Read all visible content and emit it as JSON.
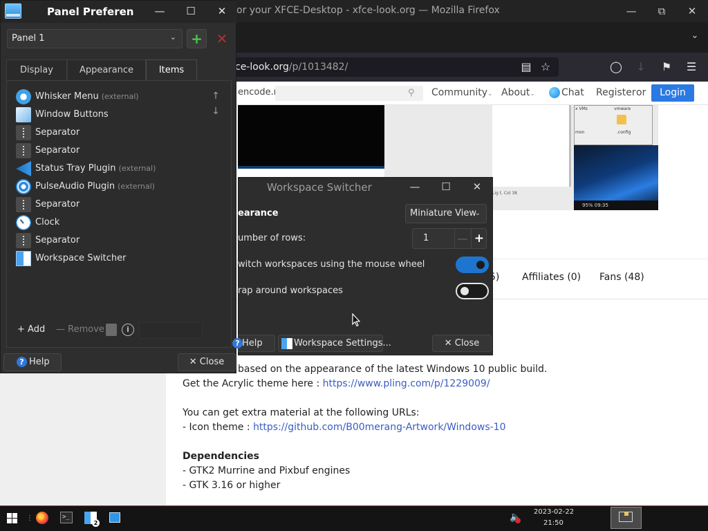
{
  "firefox": {
    "window_title": "or your XFCE-Desktop - xfce-look.org — Mozilla Firefox",
    "url_host": "ce-look.org",
    "url_path": "/p/1013482/"
  },
  "site": {
    "logo_fragment": "encode.n",
    "nav": {
      "community": "Community",
      "about": "About",
      "chat": "Chat",
      "register": "Register",
      "or": "or",
      "login": "Login"
    },
    "screenshot": {
      "label1": "x VMs",
      "label2": "vmware",
      "label3": "mon",
      "label4": ".config",
      "statusline": "Lig t, Col 38",
      "taskbar_text": "95%  09:35"
    },
    "tabs": {
      "partial": "5)",
      "affiliates": "Affiliates (0)",
      "fans": "Fans (48)"
    },
    "description": {
      "line1": "based on the appearance of the latest Windows 10 public build.",
      "line2_prefix": "Get the Acrylic theme here : ",
      "line2_link": "https://www.pling.com/p/1229009/",
      "line3": "You can get extra material at the following URLs:",
      "line4_prefix": "- Icon theme : ",
      "line4_link": "https://github.com/B00merang-Artwork/Windows-10",
      "deps_heading": "Dependencies",
      "dep1": "- GTK2 Murrine and Pixbuf engines",
      "dep2": "- GTK 3.16 or higher"
    }
  },
  "panel_prefs": {
    "title": "Panel Preferen",
    "selected_panel": "Panel 1",
    "tabs": [
      "Display",
      "Appearance",
      "Items"
    ],
    "active_tab": "Items",
    "items": [
      {
        "label": "Whisker Menu",
        "external": "(external)",
        "icon": "whisker-menu-icon"
      },
      {
        "label": "Window Buttons",
        "external": "",
        "icon": "window-buttons-icon"
      },
      {
        "label": "Separator",
        "external": "",
        "icon": "separator-icon"
      },
      {
        "label": "Separator",
        "external": "",
        "icon": "separator-icon"
      },
      {
        "label": "Status Tray Plugin",
        "external": "(external)",
        "icon": "status-tray-icon"
      },
      {
        "label": "PulseAudio Plugin",
        "external": "(external)",
        "icon": "pulseaudio-icon"
      },
      {
        "label": "Separator",
        "external": "",
        "icon": "separator-icon"
      },
      {
        "label": "Clock",
        "external": "",
        "icon": "clock-icon"
      },
      {
        "label": "Separator",
        "external": "",
        "icon": "separator-icon"
      },
      {
        "label": "Workspace Switcher",
        "external": "",
        "icon": "workspace-switcher-icon"
      }
    ],
    "add_label": "Add",
    "remove_label": "Remove",
    "help_label": "Help",
    "close_label": "Close"
  },
  "workspace_switcher": {
    "title": "Workspace Switcher",
    "appearance_label": "earance",
    "appearance_value": "Miniature View",
    "rows_label": "umber of rows:",
    "rows_value": "1",
    "mouse_wheel_label": "witch workspaces using the mouse wheel",
    "mouse_wheel_on": true,
    "wrap_label": "rap around workspaces",
    "wrap_on": false,
    "help_label": "Help",
    "settings_label": "Workspace Settings...",
    "close_label": "Close"
  },
  "taskbar": {
    "date": "2023-02-22",
    "time": "21:50",
    "workspace_badge": "2"
  },
  "colors": {
    "accent": "#1e75d0",
    "link": "#3a5cc5",
    "login_button": "#2a7ae2",
    "add_green": "#4cc34c",
    "remove_red": "#b33030",
    "taskbar_border": "#b83a3a"
  }
}
